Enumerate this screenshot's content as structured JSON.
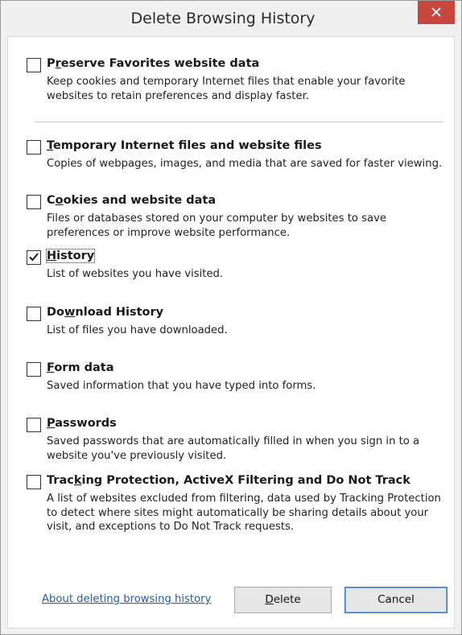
{
  "window": {
    "title": "Delete Browsing History"
  },
  "options": [
    {
      "title_parts": [
        "P",
        "r",
        "eserve Favorites website data"
      ],
      "description": "Keep cookies and temporary Internet files that enable your favorite websites to retain preferences and display faster.",
      "checked": false
    },
    {
      "title_parts": [
        "",
        "T",
        "emporary Internet files and website files"
      ],
      "description": "Copies of webpages, images, and media that are saved for faster viewing.",
      "checked": false
    },
    {
      "title_parts": [
        "C",
        "o",
        "okies and website data"
      ],
      "description": "Files or databases stored on your computer by websites to save preferences or improve website performance.",
      "checked": false
    },
    {
      "title_parts": [
        "",
        "H",
        "istory"
      ],
      "description": "List of websites you have visited.",
      "checked": true
    },
    {
      "title_parts": [
        "Do",
        "w",
        "nload History"
      ],
      "description": "List of files you have downloaded.",
      "checked": false
    },
    {
      "title_parts": [
        "",
        "F",
        "orm data"
      ],
      "description": "Saved information that you have typed into forms.",
      "checked": false
    },
    {
      "title_parts": [
        "",
        "P",
        "asswords"
      ],
      "description": "Saved passwords that are automatically filled in when you sign in to a website you've previously visited.",
      "checked": false
    },
    {
      "title_parts": [
        "Trac",
        "k",
        "ing Protection, ActiveX Filtering and Do Not Track"
      ],
      "description": "A list of websites excluded from filtering, data used by Tracking Protection to detect where sites might automatically be sharing details about your visit, and exceptions to Do Not Track requests.",
      "checked": false
    }
  ],
  "footer": {
    "help_link": "About deleting browsing history",
    "delete_parts": [
      "",
      "D",
      "elete"
    ],
    "cancel_label": "Cancel"
  },
  "colors": {
    "close_button": "#c7463d",
    "link": "#1f5db6",
    "default_button_border": "#3c7fd0"
  },
  "icons": {
    "close": "close-icon",
    "check": "checkmark-icon"
  }
}
